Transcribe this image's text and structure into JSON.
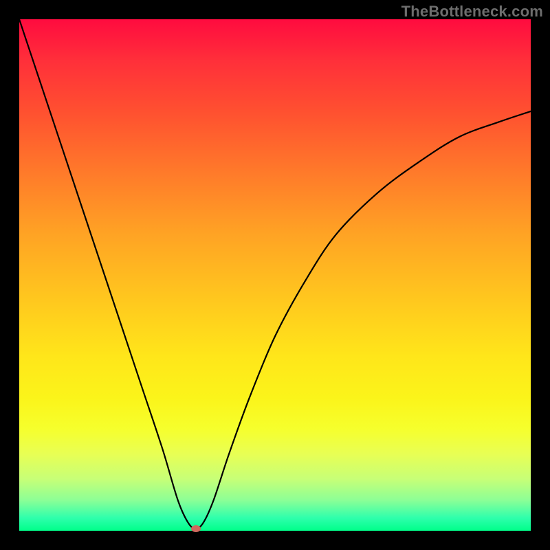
{
  "watermark": "TheBottleneck.com",
  "chart_data": {
    "type": "line",
    "title": "",
    "xlabel": "",
    "ylabel": "",
    "xlim": [
      0,
      100
    ],
    "ylim": [
      0,
      100
    ],
    "grid": false,
    "series": [
      {
        "name": "bottleneck-curve",
        "x": [
          0,
          4,
          8,
          12,
          16,
          20,
          24,
          28,
          31,
          33,
          34.5,
          36,
          38,
          41,
          45,
          50,
          56,
          62,
          70,
          78,
          86,
          94,
          100
        ],
        "y": [
          100,
          88,
          76,
          64,
          52,
          40,
          28,
          16,
          6,
          1.6,
          0.4,
          1.6,
          6,
          15,
          26,
          38,
          49,
          58,
          66,
          72,
          77,
          80,
          82
        ]
      }
    ],
    "marker": {
      "x": 34.5,
      "y": 0.4,
      "label": "optimal-point"
    }
  },
  "colors": {
    "curve": "#000000",
    "marker": "#cf6a5e",
    "background_top": "#ff0b3f",
    "background_bottom": "#00ff8a",
    "frame": "#000000"
  }
}
